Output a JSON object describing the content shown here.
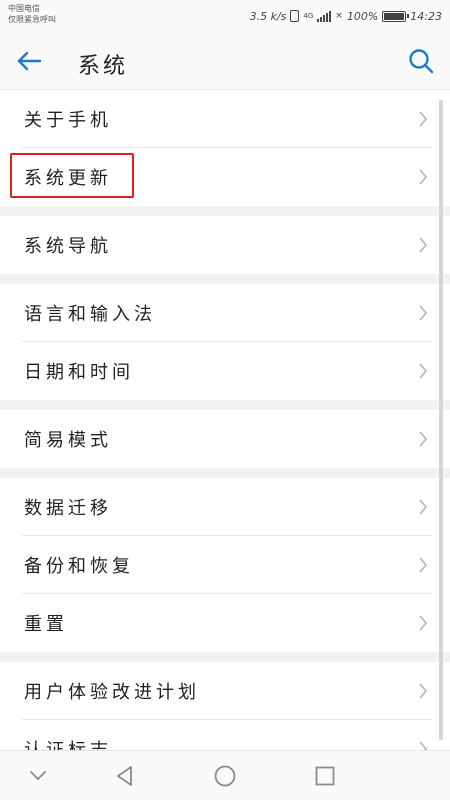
{
  "status_bar": {
    "carrier_line1": "中国电信",
    "carrier_line2": "仅限紧急呼叫",
    "speed": "3.5 k/s",
    "network": "4G",
    "battery_percent": "100%",
    "time": "14:23"
  },
  "app_bar": {
    "title": "系统",
    "back_icon": "back-arrow-icon",
    "search_icon": "search-icon",
    "accent_color": "#1a7bd0"
  },
  "menu": {
    "groups": [
      {
        "items": [
          {
            "label": "关于手机"
          },
          {
            "label": "系统更新",
            "highlighted": true
          }
        ]
      },
      {
        "items": [
          {
            "label": "系统导航"
          }
        ]
      },
      {
        "items": [
          {
            "label": "语言和输入法"
          },
          {
            "label": "日期和时间"
          }
        ]
      },
      {
        "items": [
          {
            "label": "简易模式"
          }
        ]
      },
      {
        "items": [
          {
            "label": "数据迁移"
          },
          {
            "label": "备份和恢复"
          },
          {
            "label": "重置"
          }
        ]
      },
      {
        "items": [
          {
            "label": "用户体验改进计划"
          },
          {
            "label": "认证标志"
          }
        ]
      }
    ],
    "highlight_color": "#e02020"
  },
  "nav_bar": {
    "icons": [
      "hide-keyboard-icon",
      "back-triangle-icon",
      "home-circle-icon",
      "recents-square-icon"
    ]
  }
}
